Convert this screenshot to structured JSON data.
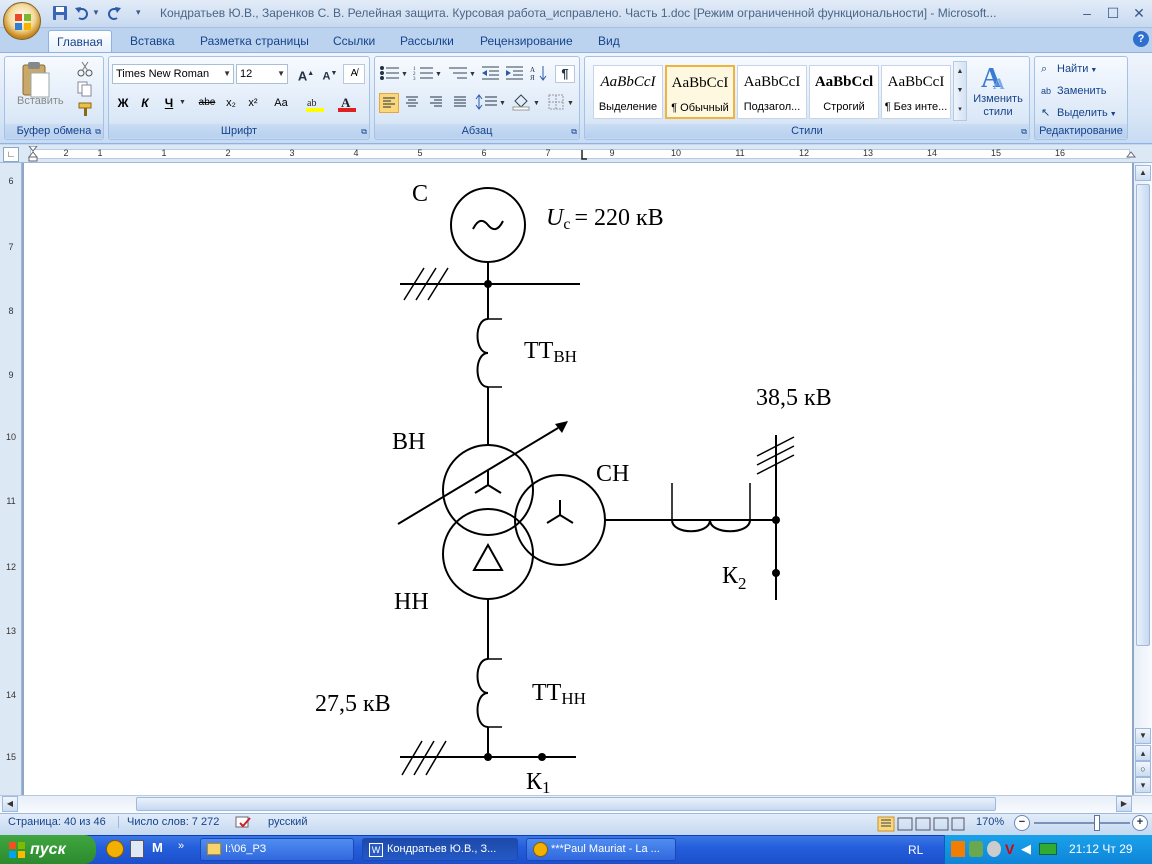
{
  "window": {
    "title": "Кондратьев Ю.В., Заренков С. В. Релейная защита. Курсовая работа_исправлено. Часть 1.doc [Режим ограниченной функциональности] - Microsoft...",
    "minimize": "‒",
    "maximize": "☐",
    "close": "✕"
  },
  "tabs": [
    "Главная",
    "Вставка",
    "Разметка страницы",
    "Ссылки",
    "Рассылки",
    "Рецензирование",
    "Вид"
  ],
  "ribbon": {
    "clipboard": {
      "label": "Буфер обмена",
      "paste": "Вставить"
    },
    "font": {
      "label": "Шрифт",
      "family": "Times New Roman",
      "size": "12",
      "bold": "Ж",
      "italic": "К",
      "underline": "Ч",
      "strike": "abe",
      "subscript": "x₂",
      "superscript": "x²",
      "case": "Aa"
    },
    "paragraph": {
      "label": "Абзац"
    },
    "styles": {
      "label": "Стили",
      "items": [
        {
          "sample": "AaBbCcI",
          "name": "Выделение"
        },
        {
          "sample": "AaBbCcI",
          "name": "¶ Обычный"
        },
        {
          "sample": "AaBbCcI",
          "name": "Подзагол..."
        },
        {
          "sample": "AaBbCcl",
          "name": "Строгий"
        },
        {
          "sample": "AaBbCcI",
          "name": "¶ Без инте..."
        }
      ],
      "change": "Изменить стили"
    },
    "editing": {
      "label": "Редактирование",
      "find": "Найти",
      "replace": "Заменить",
      "select": "Выделить"
    }
  },
  "ruler": {
    "h": [
      "3",
      "2",
      "1",
      "1",
      "2",
      "3",
      "4",
      "5",
      "6",
      "7",
      "8",
      "9",
      "10",
      "11",
      "12",
      "13",
      "14",
      "15",
      "16"
    ],
    "v": [
      "6",
      "7",
      "8",
      "9",
      "10",
      "11",
      "12",
      "13",
      "14",
      "15"
    ]
  },
  "diagram": {
    "source": "С",
    "voltage_prefix": "U",
    "voltage_sub": "с",
    "voltage_value": "= 220 кВ",
    "tt_hv": "ТТ",
    "tt_hv_sub": "ВН",
    "hv": "ВН",
    "mv": "СН",
    "lv": "НН",
    "mv_voltage": "38,5 кВ",
    "lv_voltage": "27,5 кВ",
    "k2": "К",
    "k2_sub": "2",
    "tt_lv": "ТТ",
    "tt_lv_sub": "НН",
    "k1": "К",
    "k1_sub": "1"
  },
  "status": {
    "page": "Страница: 40 из 46",
    "words": "Число слов: 7 272",
    "language": "русский",
    "zoom": "170%"
  },
  "taskbar": {
    "start": "пуск",
    "tasks": [
      "I:\\06_РЗ",
      "Кондратьев Ю.В., З...",
      "***Paul Mauriat - La ..."
    ],
    "lang": "RL",
    "clock": "21:12 Чт 29"
  },
  "colors": {
    "ribbon_text": "#15428b",
    "taskbar": "#245edb",
    "start": "#3fa640",
    "selected_style": "#f1b23e"
  }
}
